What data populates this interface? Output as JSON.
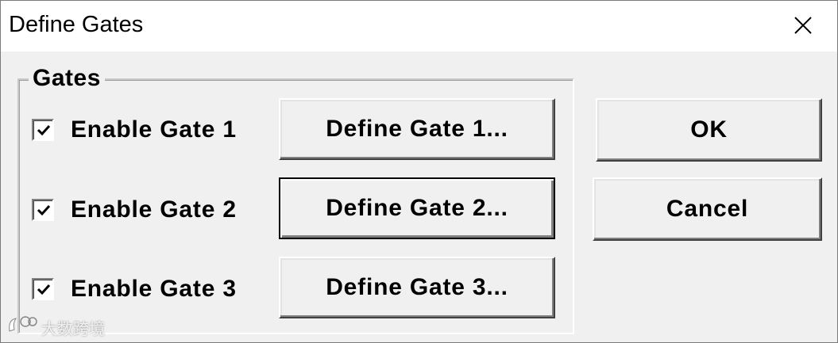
{
  "window": {
    "title": "Define Gates"
  },
  "gates_group": {
    "label": "Gates",
    "rows": [
      {
        "checkbox_label": "Enable Gate 1",
        "checked": true,
        "button_label": "Define Gate 1..."
      },
      {
        "checkbox_label": "Enable Gate 2",
        "checked": true,
        "button_label": "Define Gate 2..."
      },
      {
        "checkbox_label": "Enable Gate 3",
        "checked": true,
        "button_label": "Define Gate 3..."
      }
    ]
  },
  "actions": {
    "ok_label": "OK",
    "cancel_label": "Cancel"
  },
  "watermark": {
    "text": "大数跨境"
  },
  "icons": {
    "close": "close-icon",
    "check": "checkmark-icon",
    "watermark_logo": "logo-icon"
  }
}
